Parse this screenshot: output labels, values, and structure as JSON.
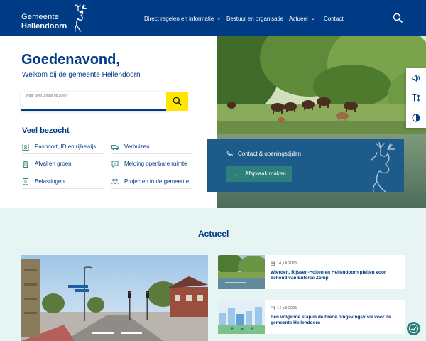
{
  "header": {
    "logo": {
      "line1": "Gemeente",
      "line2": "Hellendoorn"
    },
    "nav": [
      {
        "label": "Direct regelen en informatie",
        "dropdown": true
      },
      {
        "label": "Bestuur en organisatie",
        "dropdown": false
      },
      {
        "label": "Actueel",
        "dropdown": true
      },
      {
        "label": "Contact",
        "dropdown": false
      }
    ],
    "search_icon": "search-icon"
  },
  "hero": {
    "greeting": "Goedenavond,",
    "welcome": "Welkom bij de gemeente Hellendoorn",
    "search": {
      "placeholder": "Waar bent u naar op zoek?",
      "value": ""
    },
    "search_button_icon": "search-icon"
  },
  "veel_bezocht": {
    "title": "Veel bezocht",
    "links": [
      {
        "label": "Paspoort, ID en rijbewijs",
        "icon": "id-card-icon"
      },
      {
        "label": "Verhuizen",
        "icon": "truck-icon"
      },
      {
        "label": "Afval en groen",
        "icon": "trash-icon"
      },
      {
        "label": "Melding openbare ruimte",
        "icon": "speech-bubble-icon"
      },
      {
        "label": "Belastingen",
        "icon": "receipt-icon"
      },
      {
        "label": "Projecten in de gemeente",
        "icon": "people-icon"
      }
    ]
  },
  "contact_card": {
    "contact_label": "Contact & openingstijden",
    "appointment_button": "Afspraak maken"
  },
  "side_tools": [
    "speaker-icon",
    "text-size-icon",
    "contrast-icon"
  ],
  "actueel": {
    "title": "Actueel",
    "news": [
      {
        "date": "14 juli 2025",
        "title": "Wierden, Rijssen-Holten en Hellendoorn pleiten voor behoud van Enterse Zomp"
      },
      {
        "date": "14 juli 2025",
        "title": "Een volgende stap in de brede omgevingsvisie voor de gemeente Hellendoorn"
      }
    ]
  },
  "colors": {
    "brand_blue": "#003b85",
    "accent_yellow": "#ffe500",
    "teal": "#2c7f7a",
    "section_bg": "#e6f4f3"
  }
}
